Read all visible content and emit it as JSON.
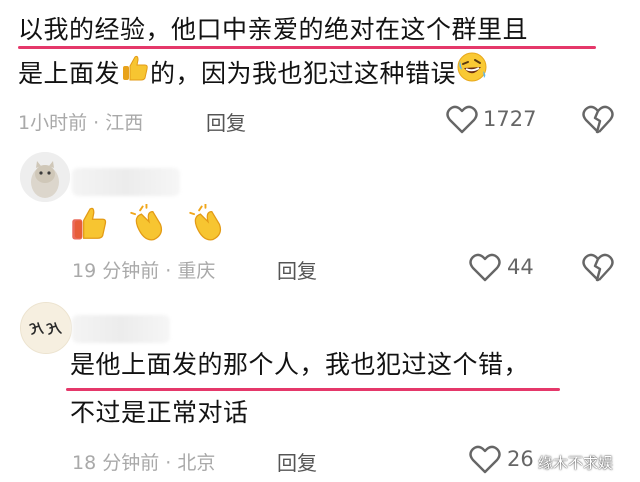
{
  "comment1": {
    "line1": "以我的经验，他口中亲爱的绝对在这个群里且",
    "line2_before": "是上面发",
    "line2_after": "的，因为我也犯过这种错误",
    "time": "1小时前 · 江西",
    "reply": "回复",
    "likes": "1727",
    "emoji_thumbs": "thumbs-up-emoji",
    "emoji_laugh": "rolling-laughing-emoji"
  },
  "comment2": {
    "emojis": [
      "thumbs-up-emoji",
      "clapping-hands-emoji",
      "clapping-hands-emoji"
    ],
    "time": "19 分钟前 · 重庆",
    "reply": "回复",
    "likes": "44"
  },
  "comment3": {
    "line1": "是他上面发的那个人，我也犯过这个错，",
    "line2": "不过是正常对话",
    "time": "18 分钟前 · 北京",
    "reply": "回复",
    "likes": "26"
  },
  "watermark": "缘木不求娱",
  "colors": {
    "underline": "#e5386a",
    "meta": "#a9a9a9",
    "text": "#121212"
  }
}
